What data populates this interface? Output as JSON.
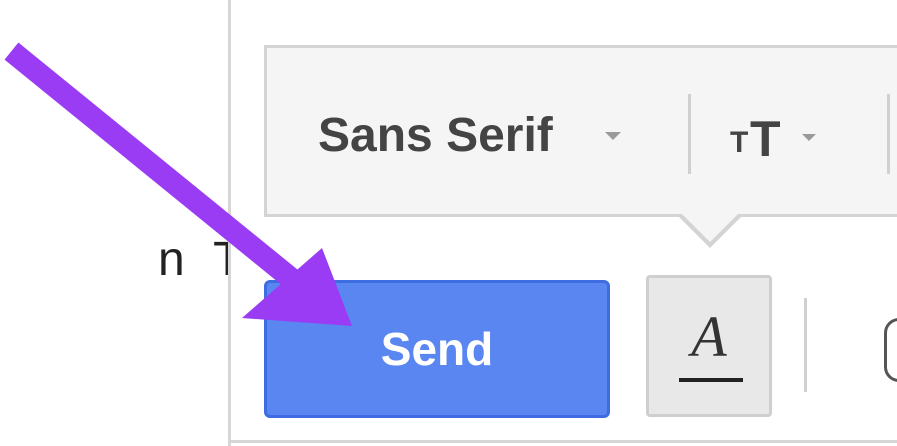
{
  "background_text": {
    "fragment": "n T"
  },
  "toolbar": {
    "font_family": "Sans Serif",
    "font_size_icon": "size-icon",
    "small_t": "T",
    "big_t": "T"
  },
  "actions": {
    "send_label": "Send",
    "formatting_label": "A"
  },
  "annotation": {
    "arrow_color": "#9b3cf5"
  },
  "colors": {
    "send_button": "#5a86f1",
    "toolbar_bg": "#f5f5f5"
  }
}
